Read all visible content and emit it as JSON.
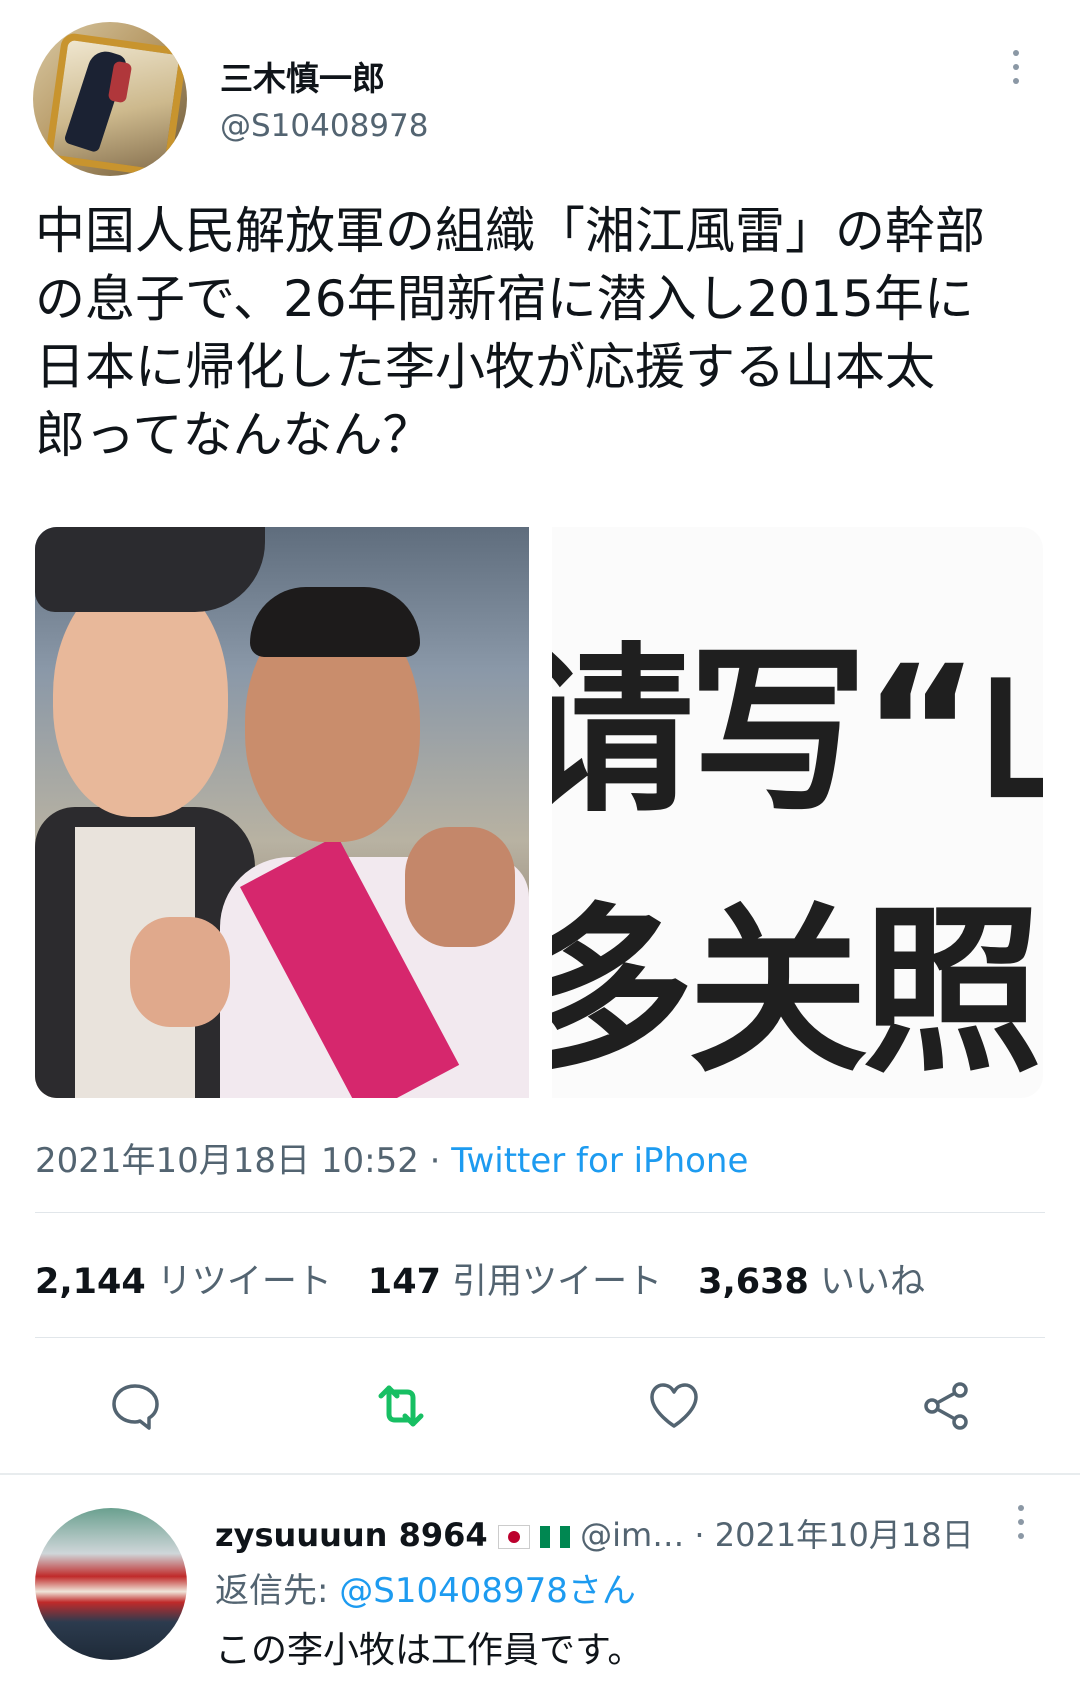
{
  "tweet": {
    "display_name": "三木慎一郎",
    "handle": "@S10408978",
    "text": "中国人民解放軍の組織「湘江風雷」の幹部\nの息子で、26年間新宿に潜入し2015年に\n日本に帰化した李小牧が応援する山本太\n郎ってなんなん？",
    "timestamp": "2021年10月18日 10:52",
    "separator": " · ",
    "source": "Twitter for iPhone",
    "media": {
      "image2_line1": "请写“山",
      "image2_line2": "多关照"
    }
  },
  "stats": {
    "retweets_count": "2,144",
    "retweets_label": "リツイート",
    "quotes_count": "147",
    "quotes_label": "引用ツイート",
    "likes_count": "3,638",
    "likes_label": "いいね"
  },
  "actions": {
    "icons": [
      "reply-icon",
      "retweet-icon",
      "like-icon",
      "share-icon"
    ],
    "retweet_color": "#17bf63"
  },
  "reply": {
    "display_name": "zysuuuun 8964",
    "handle": "@im…",
    "date": "· 2021年10月18日",
    "reply_to_label": "返信先: ",
    "reply_to_mention": "@S10408978さん",
    "text": "この李小牧は工作員です。"
  },
  "colors": {
    "text": "#0f1419",
    "muted": "#536471",
    "link": "#1d9bf0",
    "divider": "#e1e6ea"
  }
}
